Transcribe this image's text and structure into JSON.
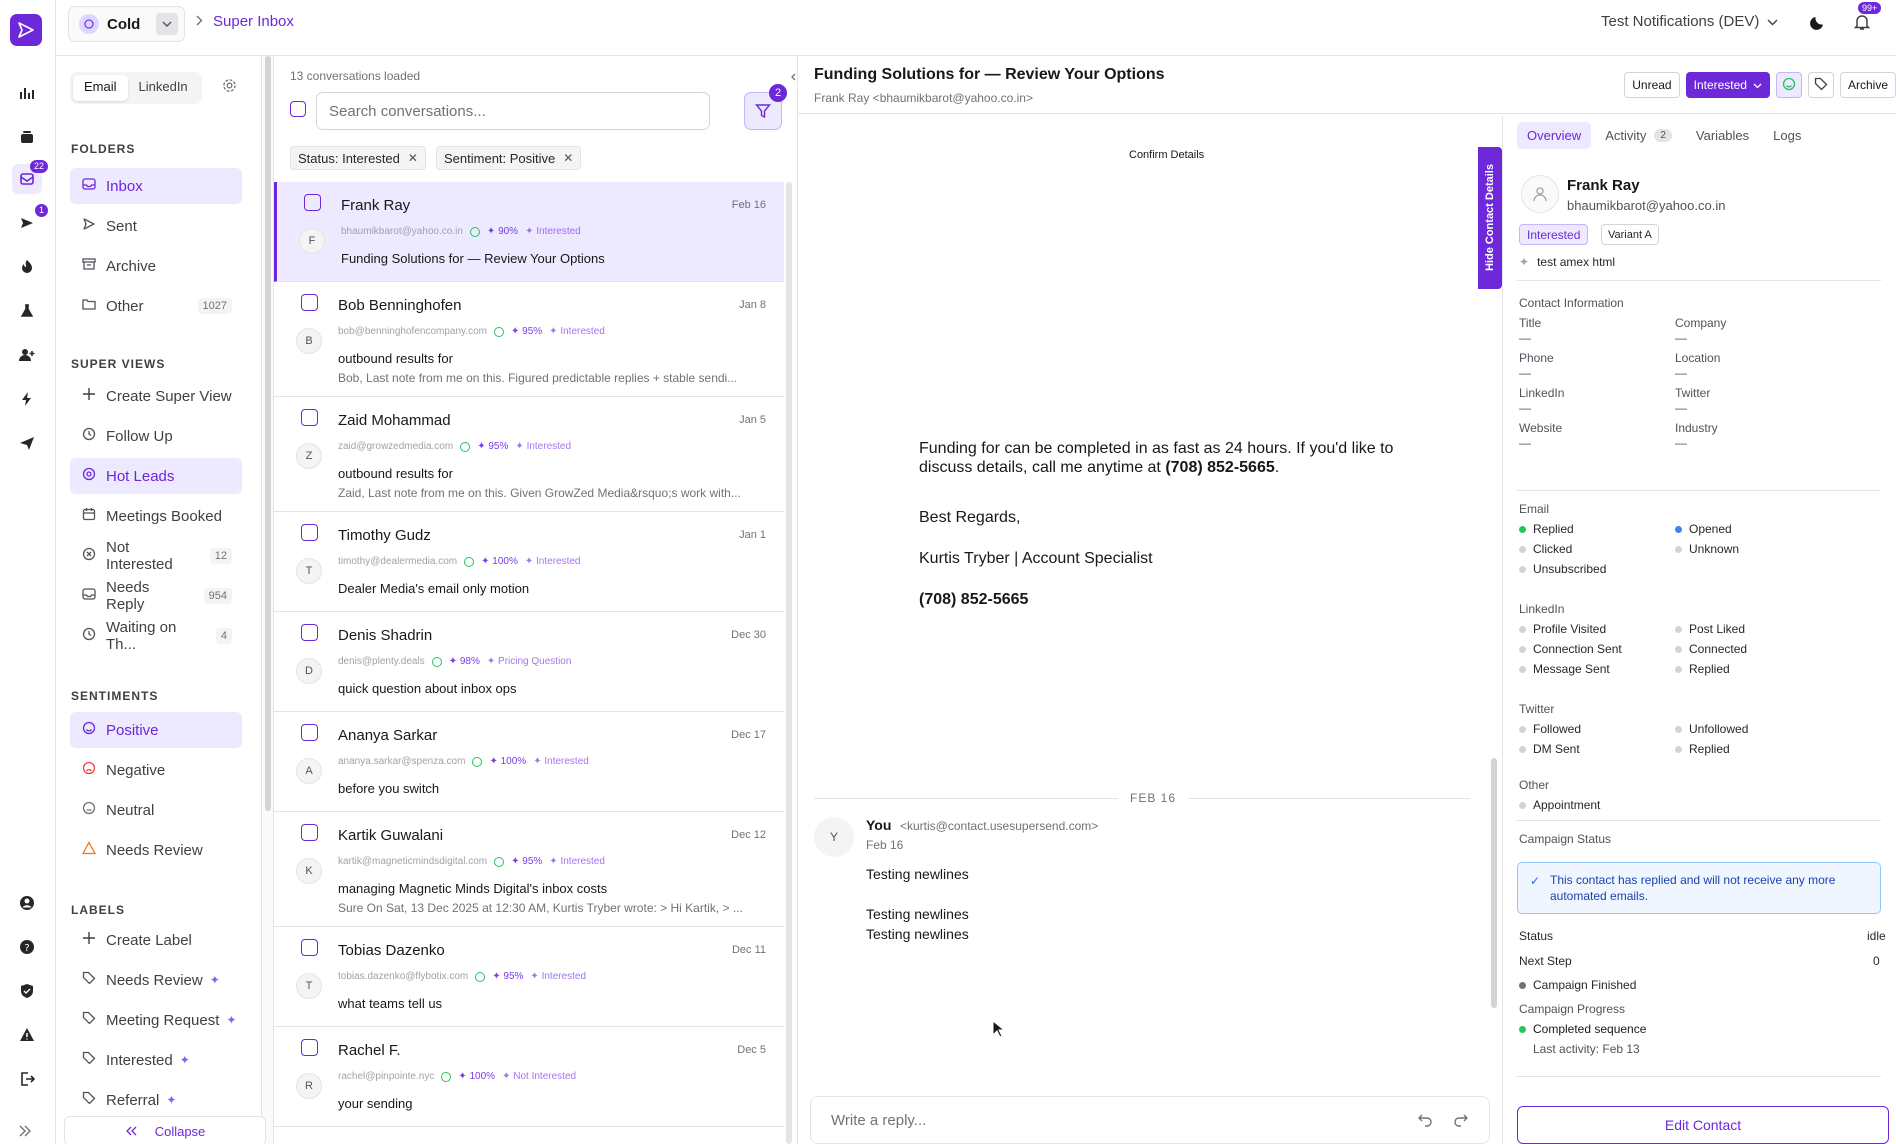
{
  "workspace": {
    "name": "Cold"
  },
  "breadcrumb": {
    "current": "Super Inbox"
  },
  "account": {
    "name": "Test Notifications (DEV)"
  },
  "notifications": {
    "count": "99+"
  },
  "rail": {
    "inbox_badge": "22",
    "send_badge": "1"
  },
  "sidebar": {
    "tabs": [
      "Email",
      "LinkedIn"
    ],
    "folders_title": "FOLDERS",
    "folders": [
      {
        "label": "Inbox"
      },
      {
        "label": "Sent"
      },
      {
        "label": "Archive"
      },
      {
        "label": "Other",
        "count": "1027"
      }
    ],
    "super_views_title": "SUPER VIEWS",
    "super_views": [
      {
        "label": "Create Super View"
      },
      {
        "label": "Follow Up"
      },
      {
        "label": "Hot Leads"
      },
      {
        "label": "Meetings Booked"
      },
      {
        "label": "Not Interested",
        "count": "12"
      },
      {
        "label": "Needs Reply",
        "count": "954"
      },
      {
        "label": "Waiting on Th...",
        "count": "4"
      }
    ],
    "sentiments_title": "SENTIMENTS",
    "sentiments": [
      {
        "label": "Positive"
      },
      {
        "label": "Negative"
      },
      {
        "label": "Neutral"
      },
      {
        "label": "Needs Review"
      }
    ],
    "labels_title": "LABELS",
    "labels": [
      {
        "label": "Create Label"
      },
      {
        "label": "Needs Review"
      },
      {
        "label": "Meeting Request"
      },
      {
        "label": "Interested"
      },
      {
        "label": "Referral"
      }
    ],
    "collapse_label": "Collapse"
  },
  "list": {
    "loaded": "13 conversations loaded",
    "search_placeholder": "Search conversations...",
    "filter_count": "2",
    "chips": [
      "Status: Interested",
      "Sentiment: Positive"
    ],
    "rows": [
      {
        "name": "Frank Ray",
        "date": "Feb 16",
        "initial": "F",
        "email": "bhaumikbarot@yahoo.co.in",
        "pct": "90%",
        "tag": "Interested",
        "subject": "Funding Solutions for — Review Your Options",
        "preview": ""
      },
      {
        "name": "Bob Benninghofen",
        "date": "Jan 8",
        "initial": "B",
        "email": "bob@benninghofencompany.com",
        "pct": "95%",
        "tag": "Interested",
        "subject": "outbound results for",
        "preview": "Bob, Last note from me on this. Figured predictable replies + stable sendi..."
      },
      {
        "name": "Zaid Mohammad",
        "date": "Jan 5",
        "initial": "Z",
        "email": "zaid@growzedmedia.com",
        "pct": "95%",
        "tag": "Interested",
        "subject": "outbound results for",
        "preview": "Zaid, Last note from me on this. Given GrowZed Media&rsquo;s work with..."
      },
      {
        "name": "Timothy Gudz",
        "date": "Jan 1",
        "initial": "T",
        "email": "timothy@dealermedia.com",
        "pct": "100%",
        "tag": "Interested",
        "subject": "Dealer Media's email only motion",
        "preview": ""
      },
      {
        "name": "Denis Shadrin",
        "date": "Dec 30",
        "initial": "D",
        "email": "denis@plenty.deals",
        "pct": "98%",
        "tag": "Pricing Question",
        "subject": "quick question about inbox ops",
        "preview": ""
      },
      {
        "name": "Ananya Sarkar",
        "date": "Dec 17",
        "initial": "A",
        "email": "ananya.sarkar@spenza.com",
        "pct": "100%",
        "tag": "Interested",
        "subject": "before you switch",
        "preview": ""
      },
      {
        "name": "Kartik Guwalani",
        "date": "Dec 12",
        "initial": "K",
        "email": "kartik@magneticmindsdigital.com",
        "pct": "95%",
        "tag": "Interested",
        "subject": "managing Magnetic Minds Digital's inbox costs",
        "preview": "Sure On Sat, 13 Dec 2025 at 12:30 AM, Kurtis Tryber wrote: > Hi Kartik, > ..."
      },
      {
        "name": "Tobias Dazenko",
        "date": "Dec 11",
        "initial": "T",
        "email": "tobias.dazenko@flybotix.com",
        "pct": "95%",
        "tag": "Interested",
        "subject": "what teams tell us",
        "preview": ""
      },
      {
        "name": "Rachel F.",
        "date": "Dec 5",
        "initial": "R",
        "email": "rachel@pinpointe.nyc",
        "pct": "100%",
        "tag": "Not Interested",
        "subject": "your sending",
        "preview": ""
      }
    ]
  },
  "reader": {
    "subject": "Funding Solutions for — Review Your Options",
    "from": "Frank Ray <bhaumikbarot@yahoo.co.in>",
    "buttons": {
      "unread": "Unread",
      "status": "Interested",
      "archive": "Archive"
    },
    "confirm": "Confirm Details",
    "email_line1": "Funding for  can be completed in as fast as 24 hours. If you'd like to discuss details, call me anytime at ",
    "email_phone": "(708) 852-5665",
    "email_end": ".",
    "regards": "Best Regards,",
    "signature": "Kurtis Tryber | Account Specialist",
    "sig_phone": "(708) 852-5665",
    "date_sep": "FEB 16",
    "reply_from": "You",
    "reply_initial": "Y",
    "reply_email": "<kurtis@contact.usesupersend.com>",
    "reply_date": "Feb 16",
    "reply_lines": [
      "Testing newlines",
      "",
      "Testing newlines",
      "Testing newlines"
    ],
    "reply_placeholder": "Write a reply...",
    "hide_tab": "Hide Contact Details"
  },
  "contact": {
    "tabs": [
      "Overview",
      "Activity",
      "Variables",
      "Logs"
    ],
    "activity_count": "2",
    "name": "Frank Ray",
    "email": "bhaumikbarot@yahoo.co.in",
    "badge_status": "Interested",
    "badge_variant": "Variant A",
    "campaign": "test amex html",
    "info_title": "Contact Information",
    "fields": [
      {
        "label": "Title",
        "value": "—"
      },
      {
        "label": "Company",
        "value": "—"
      },
      {
        "label": "Phone",
        "value": "—"
      },
      {
        "label": "Location",
        "value": "—"
      },
      {
        "label": "LinkedIn",
        "value": "—"
      },
      {
        "label": "Twitter",
        "value": "—"
      },
      {
        "label": "Website",
        "value": "—"
      },
      {
        "label": "Industry",
        "value": "—"
      }
    ],
    "email_title": "Email",
    "email_stats": [
      "Replied",
      "Opened",
      "Clicked",
      "Unknown",
      "Unsubscribed"
    ],
    "linkedin_title": "LinkedIn",
    "linkedin_stats": [
      "Profile Visited",
      "Post Liked",
      "Connection Sent",
      "Connected",
      "Message Sent",
      "Replied"
    ],
    "twitter_title": "Twitter",
    "twitter_stats": [
      "Followed",
      "Unfollowed",
      "DM Sent",
      "Replied"
    ],
    "other_title": "Other",
    "other_stats": [
      "Appointment"
    ],
    "campaign_status_title": "Campaign Status",
    "note": "This contact has replied and will not receive any more automated emails.",
    "status_label": "Status",
    "status_value": "idle",
    "next_step_label": "Next Step",
    "next_step_value": "0",
    "next_step_item": "Campaign Finished",
    "progress_label": "Campaign Progress",
    "progress_item": "Completed sequence",
    "last_activity": "Last activity: Feb 13",
    "edit_label": "Edit Contact"
  },
  "colors": {
    "accent": "#6d28d9",
    "accent_light": "#ede9fe",
    "positive": "#22c55e",
    "info": "#3b82f6"
  }
}
